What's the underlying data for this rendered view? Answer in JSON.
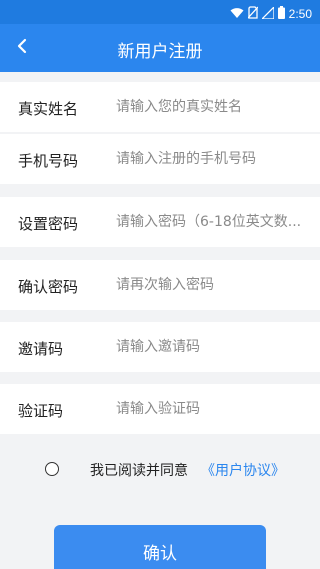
{
  "status_bar": {
    "time": "2:50",
    "icons": [
      "wifi-icon",
      "no-sim-icon",
      "cell-signal-icon",
      "battery-icon"
    ]
  },
  "header": {
    "title": "新用户注册",
    "back_icon": "chevron-left-icon"
  },
  "form": {
    "rows": [
      {
        "label": "真实姓名",
        "placeholder": "请输入您的真实姓名",
        "value": ""
      },
      {
        "label": "手机号码",
        "placeholder": "请输入注册的手机号码",
        "value": ""
      },
      {
        "label": "设置密码",
        "placeholder": "请输入密码（6-18位英文数...",
        "value": ""
      },
      {
        "label": "确认密码",
        "placeholder": "请再次输入密码",
        "value": ""
      },
      {
        "label": "邀请码",
        "placeholder": "请输入邀请码",
        "value": ""
      },
      {
        "label": "验证码",
        "placeholder": "请输入验证码",
        "value": ""
      }
    ]
  },
  "agreement": {
    "text": "我已阅读并同意",
    "link": "《用户协议》",
    "checked": false
  },
  "confirm_label": "确认",
  "colors": {
    "primary": "#2b86ee",
    "status_bar": "#1f7be0",
    "background": "#f2f3f5",
    "link": "#2b86ee"
  }
}
